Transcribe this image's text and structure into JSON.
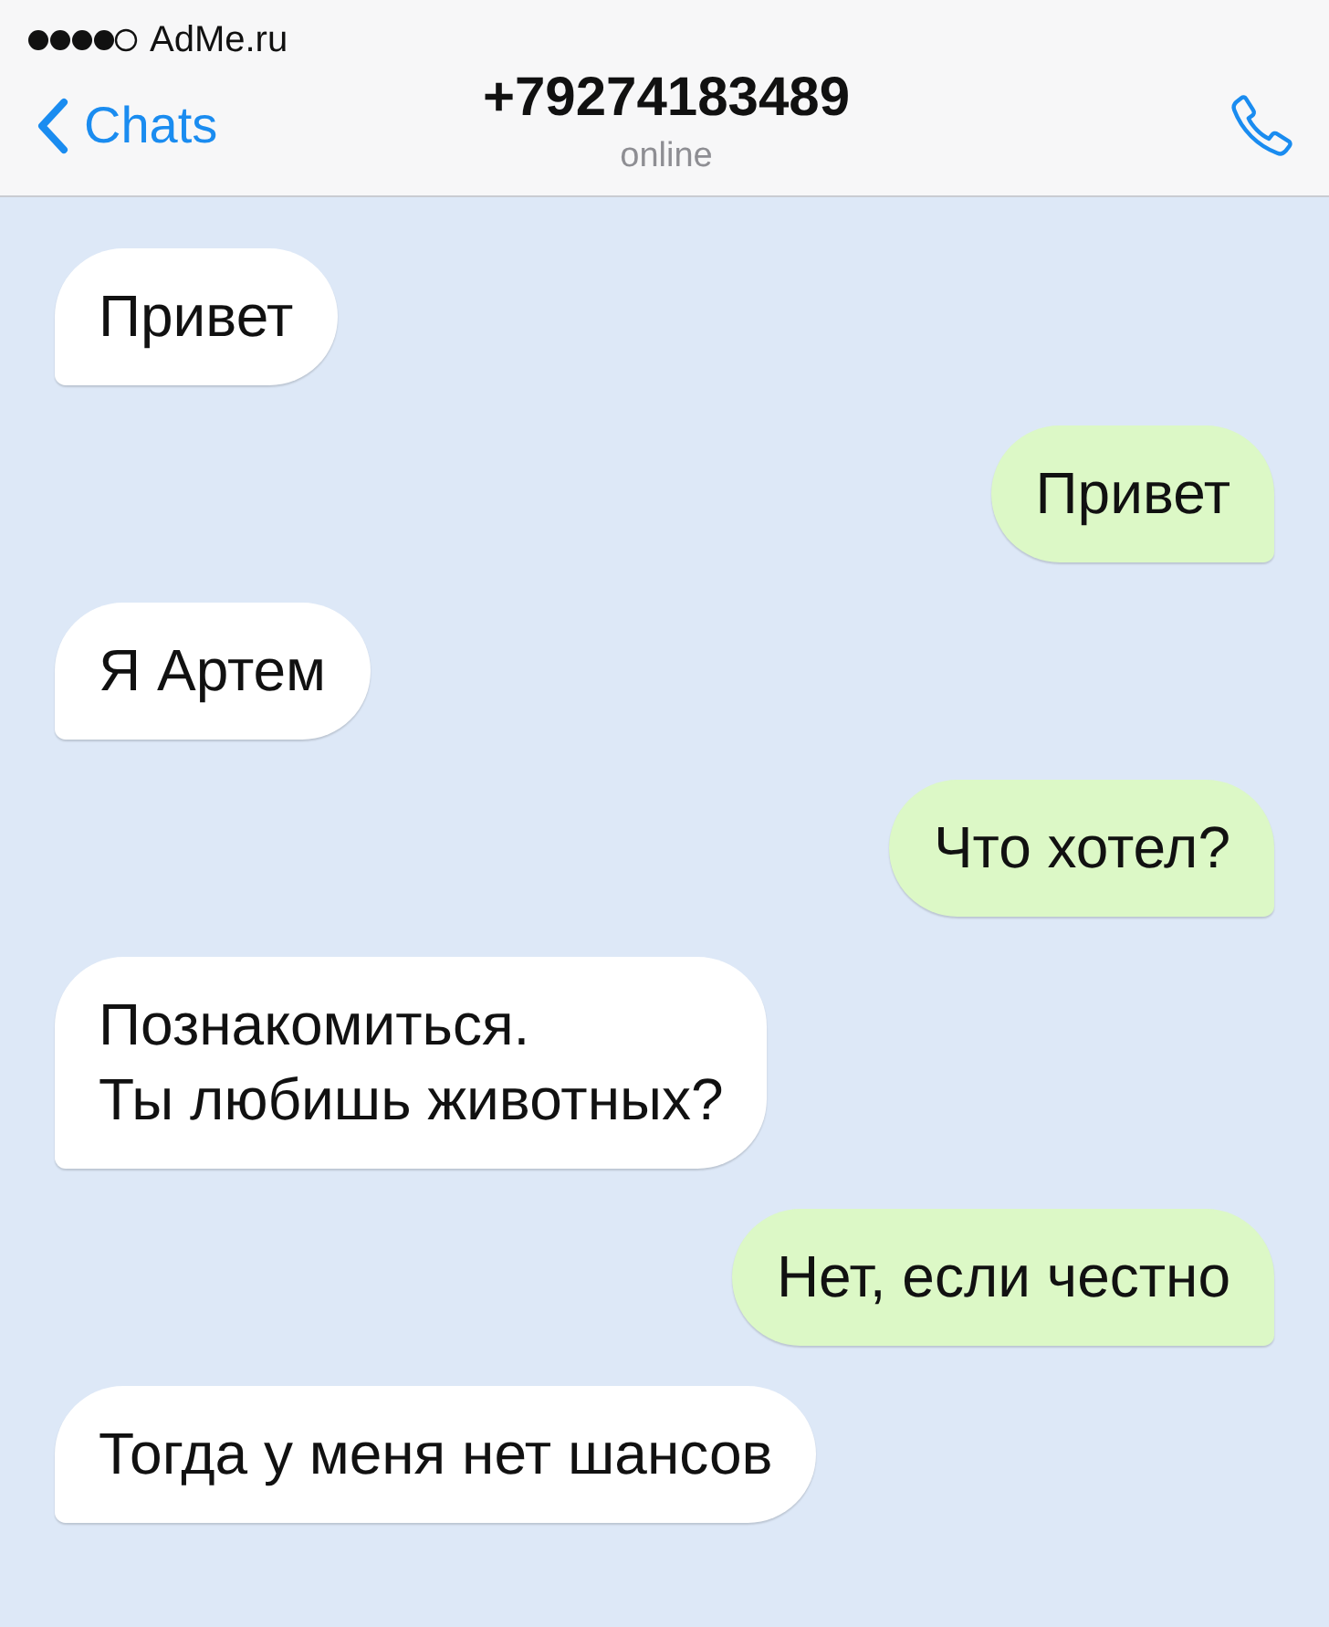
{
  "status_bar": {
    "carrier": "AdMe.ru"
  },
  "header": {
    "back_label": "Chats",
    "title": "+79274183489",
    "subtitle": "online"
  },
  "messages": [
    {
      "kind": "incoming",
      "text": "Привет"
    },
    {
      "kind": "outgoing",
      "text": "Привет"
    },
    {
      "kind": "incoming",
      "text": "Я Артем"
    },
    {
      "kind": "outgoing",
      "text": "Что хотел?"
    },
    {
      "kind": "incoming",
      "text": "Познакомиться.\nТы любишь животных?"
    },
    {
      "kind": "outgoing",
      "text": "Нет, если честно"
    },
    {
      "kind": "incoming",
      "text": "Тогда у меня нет шансов"
    }
  ]
}
